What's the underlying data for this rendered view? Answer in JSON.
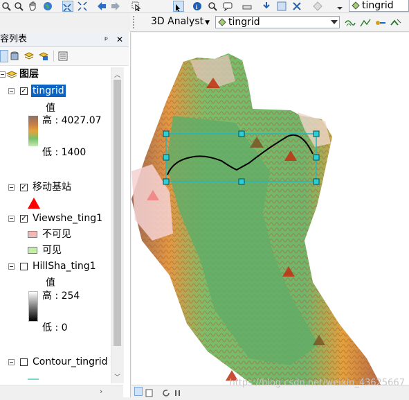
{
  "toolbar_top": {
    "layer_dropdown_value": "tingrid"
  },
  "toolbar_3d": {
    "analyst_label": "3D Analyst",
    "layer_dropdown_value": "tingrid"
  },
  "toc": {
    "title": "容列表",
    "pin_glyph": "ᵖ",
    "close_glyph": "✕",
    "root_label": "图层",
    "layers": [
      {
        "name": "tingrid",
        "checked": true,
        "selected": true,
        "legend_title": "值",
        "high_label": "高 : 4027.07",
        "low_label": "低 : 1400"
      },
      {
        "name": "移动基站",
        "checked": true,
        "symbol_color": "#ff0000"
      },
      {
        "name": "Viewshe_ting1",
        "checked": true,
        "classes": [
          {
            "label": "不可见",
            "color": "#f3b8b8"
          },
          {
            "label": "可见",
            "color": "#c6ecaa"
          }
        ]
      },
      {
        "name": "HillSha_ting1",
        "checked": false,
        "legend_title": "值",
        "high_label": "高 : 254",
        "low_label": "低 : 0"
      },
      {
        "name": "Contour_tingrid",
        "checked": false
      }
    ]
  },
  "map": {
    "observer_color": "#c03010",
    "selection_color": "#1fb8c2"
  },
  "watermark": "https://blog.csdn.net/weixin_43625667"
}
